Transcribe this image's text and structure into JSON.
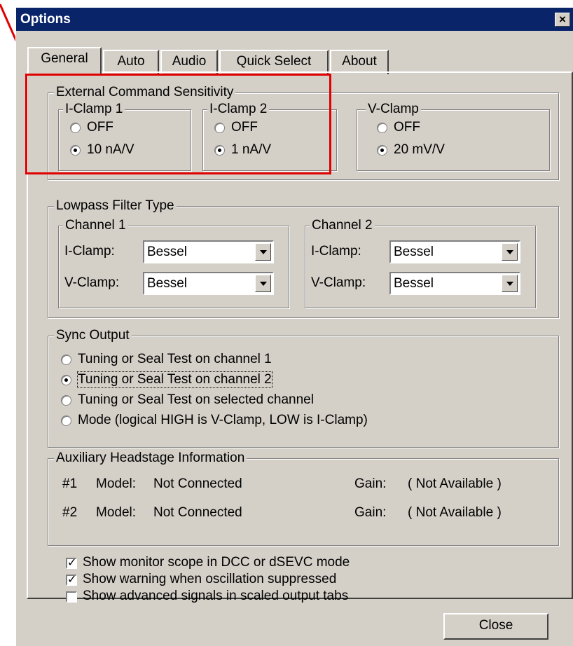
{
  "window": {
    "title": "Options",
    "close_glyph": "×"
  },
  "tabs": [
    {
      "label": "General",
      "active": true
    },
    {
      "label": "Auto",
      "active": false
    },
    {
      "label": "Audio",
      "active": false
    },
    {
      "label": "Quick Select",
      "active": false
    },
    {
      "label": "About",
      "active": false
    }
  ],
  "external_command": {
    "title": "External Command Sensitivity",
    "iclamp1": {
      "title": "I-Clamp 1",
      "off": "OFF",
      "on_value": "10 nA/V",
      "selected": "10 nA/V"
    },
    "iclamp2": {
      "title": "I-Clamp 2",
      "off": "OFF",
      "on_value": "1 nA/V",
      "selected": "1 nA/V"
    },
    "vclamp": {
      "title": "V-Clamp",
      "off": "OFF",
      "on_value": "20 mV/V",
      "selected": "20 mV/V"
    }
  },
  "lowpass": {
    "title": "Lowpass Filter Type",
    "channel1": {
      "title": "Channel 1",
      "iclamp_label": "I-Clamp:",
      "iclamp_value": "Bessel",
      "vclamp_label": "V-Clamp:",
      "vclamp_value": "Bessel"
    },
    "channel2": {
      "title": "Channel 2",
      "iclamp_label": "I-Clamp:",
      "iclamp_value": "Bessel",
      "vclamp_label": "V-Clamp:",
      "vclamp_value": "Bessel"
    }
  },
  "sync": {
    "title": "Sync Output",
    "options": [
      "Tuning or Seal Test on channel 1",
      "Tuning or Seal Test on channel 2",
      "Tuning or Seal Test on selected channel",
      "Mode (logical HIGH is V-Clamp, LOW is I-Clamp)"
    ],
    "selected_index": 1
  },
  "aux": {
    "title": "Auxiliary Headstage Information",
    "rows": [
      {
        "num": "#1",
        "model_label": "Model:",
        "model": "Not Connected",
        "gain_label": "Gain:",
        "gain": "( Not Available )"
      },
      {
        "num": "#2",
        "model_label": "Model:",
        "model": "Not Connected",
        "gain_label": "Gain:",
        "gain": "( Not Available )"
      }
    ]
  },
  "checks": [
    {
      "label": "Show monitor scope in DCC or dSEVC mode",
      "checked": true
    },
    {
      "label": "Show warning when oscillation suppressed",
      "checked": true
    },
    {
      "label": "Show advanced signals in scaled output tabs",
      "checked": false
    }
  ],
  "close_button": "Close",
  "annotation_color": "#e00000"
}
